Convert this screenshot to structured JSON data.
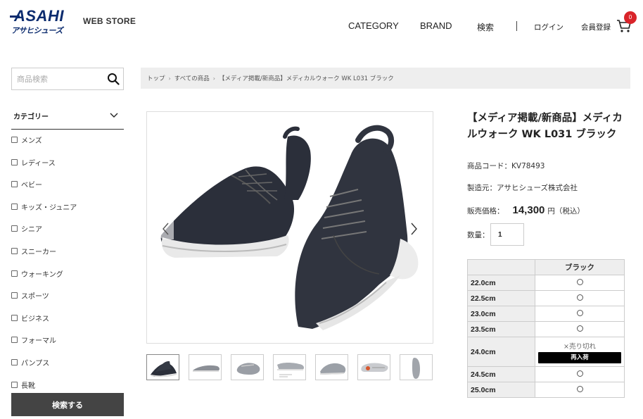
{
  "header": {
    "logo_main": "ASAHI",
    "logo_sub": "アサヒシューズ",
    "store_label": "WEB STORE",
    "nav": {
      "category": "CATEGORY",
      "brand": "BRAND",
      "search": "検索",
      "login": "ログイン",
      "register": "会員登録"
    },
    "cart_count": "0"
  },
  "sidebar": {
    "search_placeholder": "商品検索",
    "category_title": "カテゴリー",
    "categories": [
      "メンズ",
      "レディース",
      "ベビー",
      "キッズ・ジュニア",
      "シニア",
      "スニーカー",
      "ウォーキング",
      "スポーツ",
      "ビジネス",
      "フォーマル",
      "パンプス",
      "長靴"
    ],
    "submit_label": "検索する"
  },
  "breadcrumb": [
    "トップ",
    "すべての商品",
    "【メディア掲載/新商品】メディカルウォーク WK L031 ブラック"
  ],
  "product": {
    "title": "【メディア掲載/新商品】メディカルウォーク WK L031 ブラック",
    "code_label": "商品コード：",
    "code": "KV78493",
    "maker_label": "製造元：",
    "maker": "アサヒシューズ株式会社",
    "price_label": "販売価格：",
    "price": "14,300",
    "price_unit": "円（税込）",
    "qty_label": "数量：",
    "qty": "1"
  },
  "size_table": {
    "color_header": "ブラック",
    "soldout_label": "×売り切れ",
    "restock_label": "再入荷",
    "rows": [
      {
        "size": "22.0cm",
        "status": "available"
      },
      {
        "size": "22.5cm",
        "status": "available"
      },
      {
        "size": "23.0cm",
        "status": "available"
      },
      {
        "size": "23.5cm",
        "status": "available"
      },
      {
        "size": "24.0cm",
        "status": "soldout"
      },
      {
        "size": "24.5cm",
        "status": "available"
      },
      {
        "size": "25.0cm",
        "status": "available"
      }
    ]
  },
  "colors": {
    "brand_navy": "#0b2b6e",
    "badge_red": "#d9242a",
    "button_dark": "#444444",
    "shoe_dark": "#2b2f3a"
  }
}
